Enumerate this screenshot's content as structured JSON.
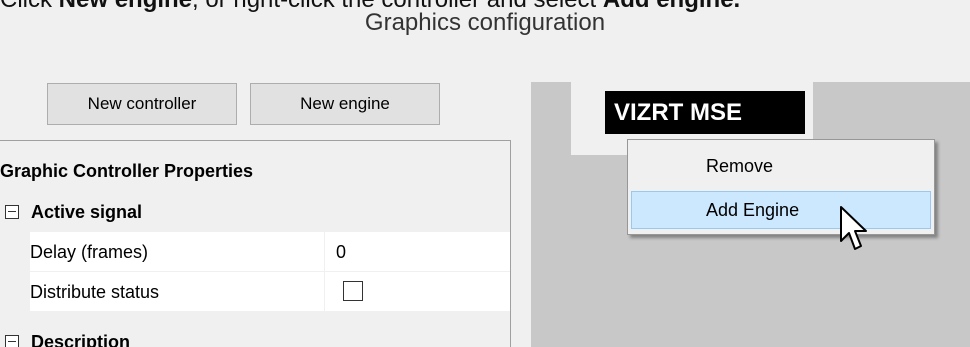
{
  "instruction": {
    "prefix": "Click ",
    "emph1": "New engine",
    "middle": ", or right-click the controller and select ",
    "emph2": "Add engine."
  },
  "window": {
    "title": "Graphics configuration"
  },
  "toolbar": {
    "new_controller_label": "New controller",
    "new_engine_label": "New engine"
  },
  "property_grid": {
    "header": "Graphic Controller Properties",
    "categories": [
      {
        "label": "Active signal",
        "expanded": true,
        "properties": [
          {
            "name": "Delay (frames)",
            "value": "0"
          },
          {
            "name": "Distribute status",
            "value": "",
            "checked": false
          }
        ]
      },
      {
        "label": "Description",
        "expanded": true
      }
    ]
  },
  "canvas": {
    "controller_node_label": "VIZRT MSE"
  },
  "context_menu": {
    "items": [
      {
        "label": "Remove",
        "selected": false
      },
      {
        "label": "Add Engine",
        "selected": true
      }
    ]
  },
  "colors": {
    "menu_highlight": "#cce8ff",
    "menu_highlight_border": "#99c9ef",
    "canvas_background": "#c8c8c8",
    "node_background": "#000000"
  }
}
